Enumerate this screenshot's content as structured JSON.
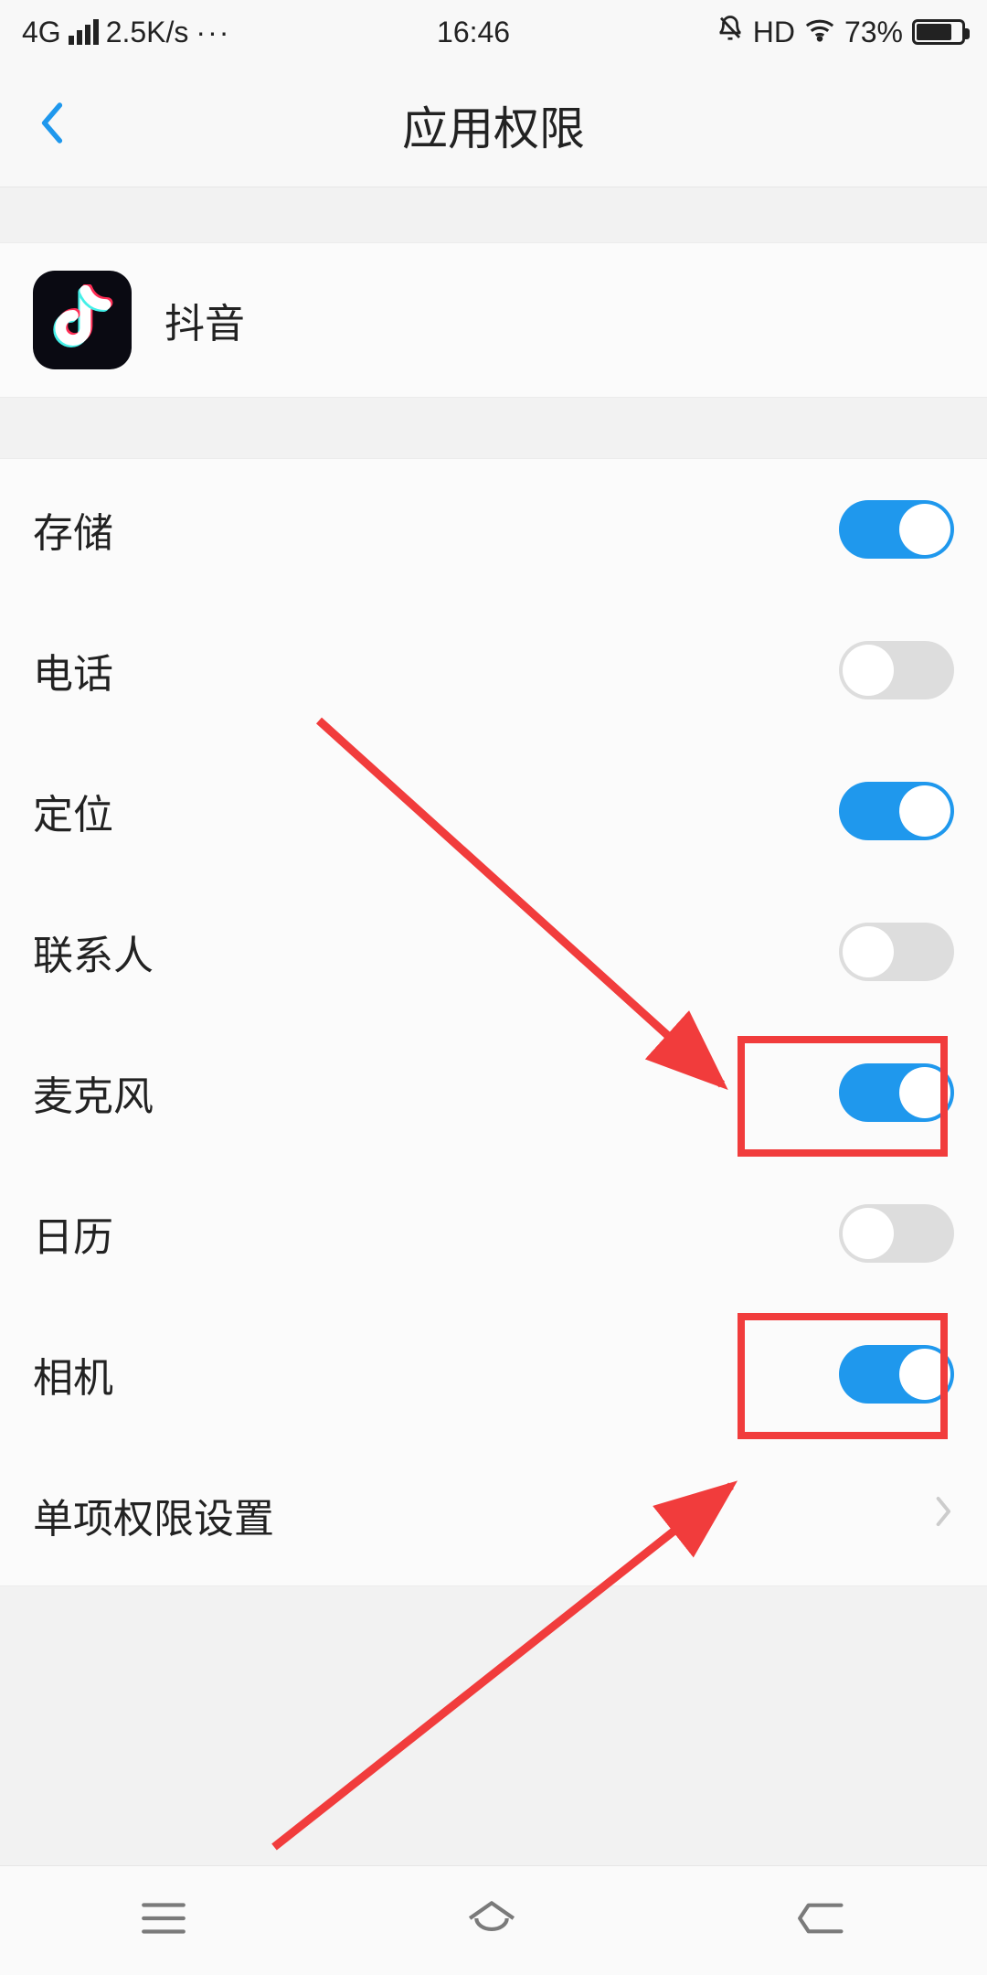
{
  "status_bar": {
    "network": "4G",
    "speed": "2.5K/s",
    "dots": "···",
    "time": "16:46",
    "hd": "HD",
    "battery_pct": "73%"
  },
  "header": {
    "title": "应用权限"
  },
  "app": {
    "name": "抖音"
  },
  "permissions": [
    {
      "label": "存储",
      "on": true
    },
    {
      "label": "电话",
      "on": false
    },
    {
      "label": "定位",
      "on": true
    },
    {
      "label": "联系人",
      "on": false
    },
    {
      "label": "麦克风",
      "on": true
    },
    {
      "label": "日历",
      "on": false
    },
    {
      "label": "相机",
      "on": true
    }
  ],
  "more_settings_label": "单项权限设置",
  "annotation": {
    "highlight_indices": [
      4,
      6
    ],
    "color": "#f13c3c"
  }
}
